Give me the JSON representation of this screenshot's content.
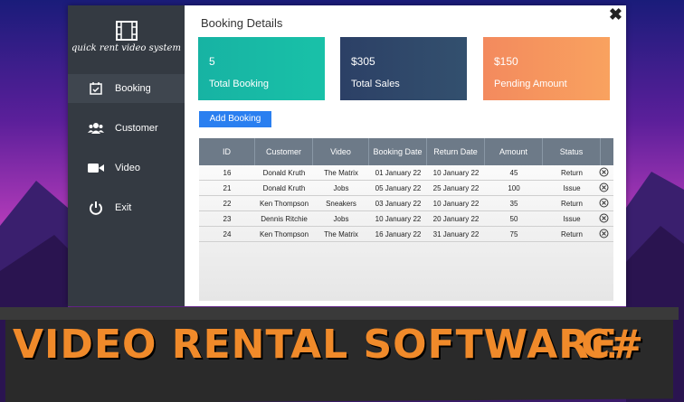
{
  "app": {
    "name": "quick rent video system"
  },
  "sidebar": {
    "items": [
      {
        "label": "Booking"
      },
      {
        "label": "Customer"
      },
      {
        "label": "Video"
      },
      {
        "label": "Exit"
      }
    ]
  },
  "main": {
    "title": "Booking Details",
    "close": "✖",
    "cards": [
      {
        "value": "5",
        "label": "Total Booking"
      },
      {
        "value": "$305",
        "label": "Total Sales"
      },
      {
        "value": "$150",
        "label": "Pending Amount"
      }
    ],
    "add_label": "Add Booking"
  },
  "table": {
    "headers": [
      "ID",
      "Customer",
      "Video",
      "Booking Date",
      "Return Date",
      "Amount",
      "Status"
    ],
    "rows": [
      [
        "16",
        "Donald Kruth",
        "The Matrix",
        "01 January 22",
        "10 January 22",
        "45",
        "Return"
      ],
      [
        "21",
        "Donald Kruth",
        "Jobs",
        "05 January 22",
        "25 January 22",
        "100",
        "Issue"
      ],
      [
        "22",
        "Ken Thompson",
        "Sneakers",
        "03 January 22",
        "10 January 22",
        "35",
        "Return"
      ],
      [
        "23",
        "Dennis Ritchie",
        "Jobs",
        "10 January 22",
        "20 January 22",
        "50",
        "Issue"
      ],
      [
        "24",
        "Ken Thompson",
        "The Matrix",
        "16 January 22",
        "31 January 22",
        "75",
        "Return"
      ]
    ]
  },
  "banner": {
    "title": "VIDEO RENTAL SOFTWARE",
    "lang": "C#"
  },
  "colors": {
    "teal": "#17b3a3",
    "navy": "#2c4066",
    "orange": "#f38a5e",
    "button": "#2a7ff0",
    "sidebar": "#343a42",
    "banner_text": "#f08a2a"
  }
}
